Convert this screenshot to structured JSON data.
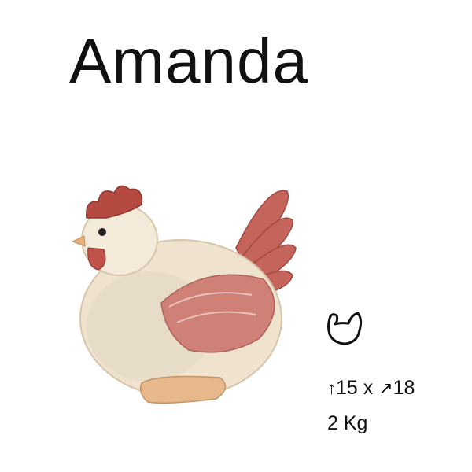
{
  "product": {
    "name": "Amanda",
    "figure_icon": "hen-figurine-illustration",
    "shape_icon": "hen-outline-icon",
    "dimensions": {
      "height_icon": "up-arrow-icon",
      "height": "15",
      "separator": "x",
      "depth_icon": "diagonal-arrow-icon",
      "depth": "18"
    },
    "weight": "2 Kg"
  },
  "colors": {
    "comb": "#b54a40",
    "body_cream": "#efe3cf",
    "wing": "#c97a70",
    "feet": "#e7b88c"
  }
}
